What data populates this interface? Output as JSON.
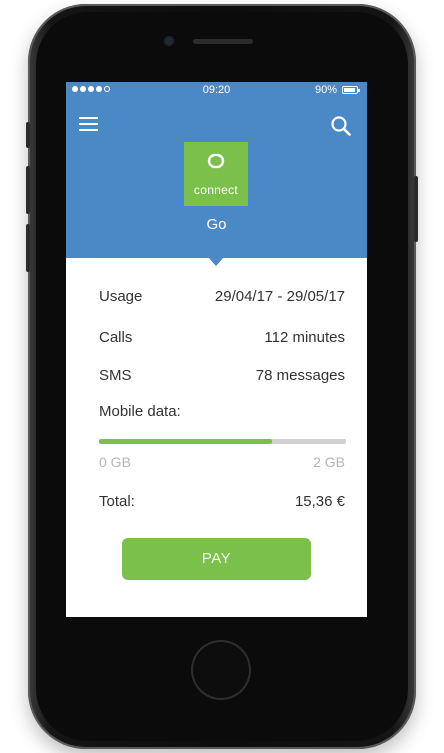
{
  "status_bar": {
    "time": "09:20",
    "battery": "90%",
    "signal_bars": 4,
    "signal_max": 5
  },
  "header": {
    "menu_icon": "hamburger-menu-icon",
    "search_icon": "search-icon",
    "logo_text": "connect",
    "plan_name": "Go"
  },
  "details": {
    "usage": {
      "label": "Usage",
      "value": "29/04/17 - 29/05/17"
    },
    "calls": {
      "label": "Calls",
      "value": "112 minutes"
    },
    "sms": {
      "label": "SMS",
      "value": "78 messages"
    },
    "mobile_data": {
      "label": "Mobile data:",
      "used_fraction": 0.7,
      "min_label": "0 GB",
      "max_label": "2 GB"
    },
    "total": {
      "label": "Total:",
      "value": "15,36 €"
    }
  },
  "pay_button": {
    "label": "PAY"
  },
  "colors": {
    "brand_blue": "#4a88c6",
    "brand_green": "#7cc04c"
  }
}
